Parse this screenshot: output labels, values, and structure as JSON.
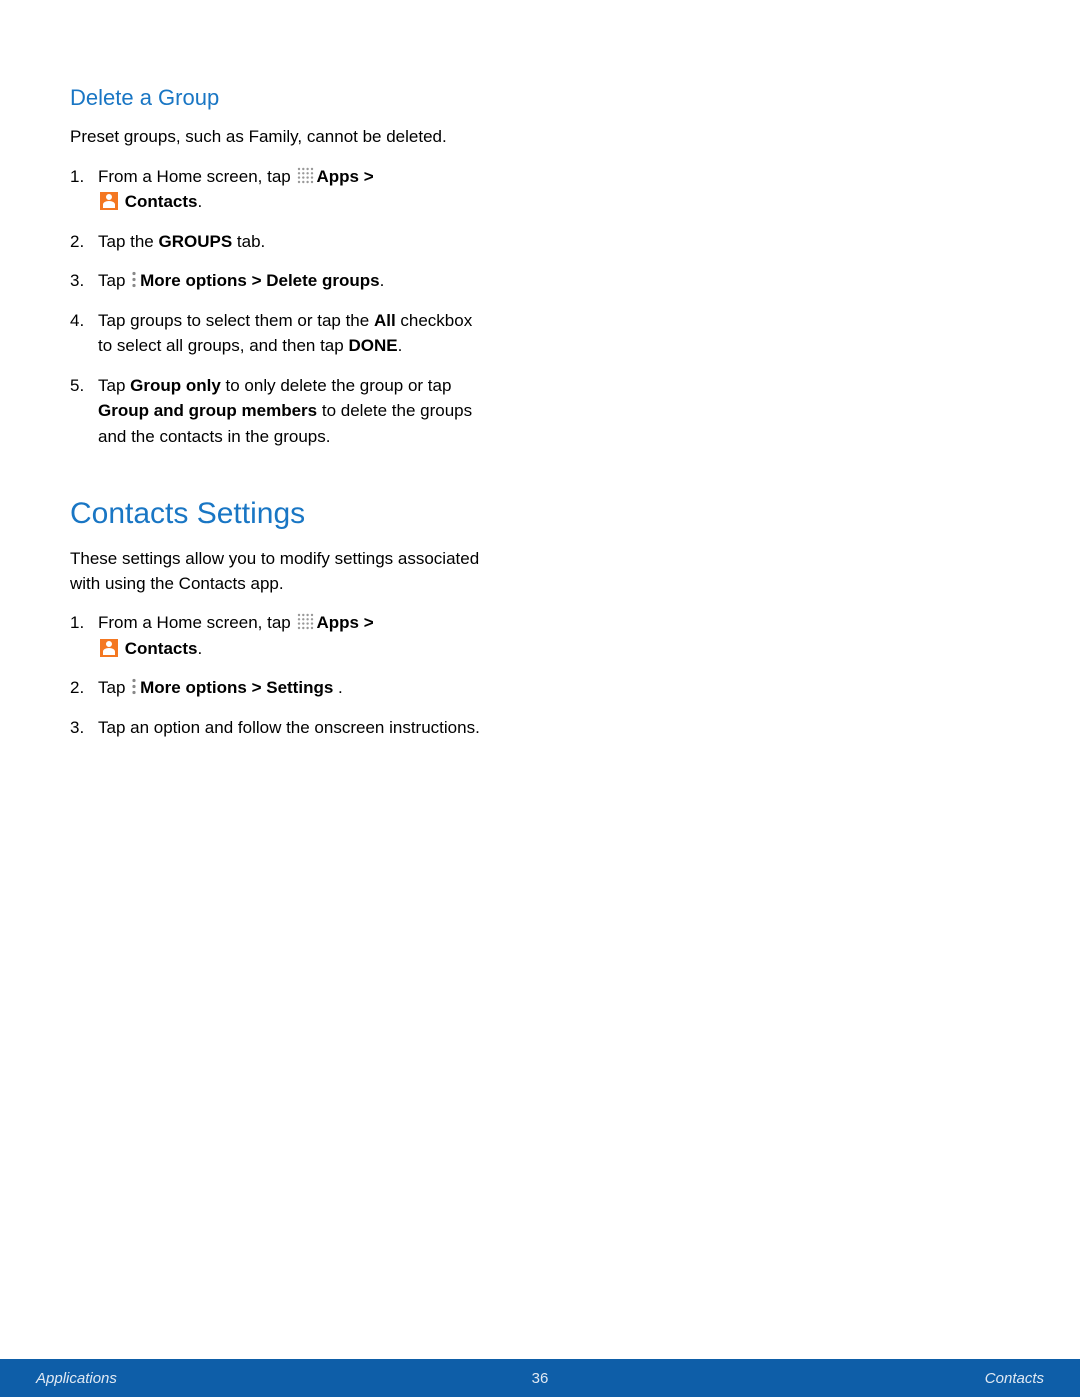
{
  "section1": {
    "heading": "Delete a Group",
    "intro": "Preset groups, such as Family, cannot be deleted.",
    "steps": {
      "s1_a": "From a Home screen, tap ",
      "s1_apps": "Apps > ",
      "s1_contacts": "Contacts",
      "s1_period": ".",
      "s2_a": "Tap the ",
      "s2_groups": "GROUPS",
      "s2_b": " tab.",
      "s3_a": "Tap ",
      "s3_b": "More options > Delete groups",
      "s3_c": ".",
      "s4_a": "Tap groups to select them or tap the ",
      "s4_all": "All",
      "s4_b": " checkbox to select all groups, and then tap ",
      "s4_done": "DONE",
      "s4_c": ".",
      "s5_a": "Tap ",
      "s5_go": "Group only",
      "s5_b": " to only delete the group or tap ",
      "s5_ggm": "Group and group members",
      "s5_c": " to delete the groups and the contacts in the groups."
    }
  },
  "section2": {
    "heading": "Contacts Settings",
    "intro": "These settings allow you to modify settings associated with using the Contacts app.",
    "steps": {
      "s1_a": "From a Home screen, tap ",
      "s1_apps": "Apps > ",
      "s1_contacts": "Contacts",
      "s1_period": ".",
      "s2_a": "Tap ",
      "s2_b": "More options > Settings ",
      "s2_c": ".",
      "s3": "Tap an option and follow the onscreen instructions."
    }
  },
  "footer": {
    "left": "Applications",
    "center": "36",
    "right": "Contacts"
  }
}
